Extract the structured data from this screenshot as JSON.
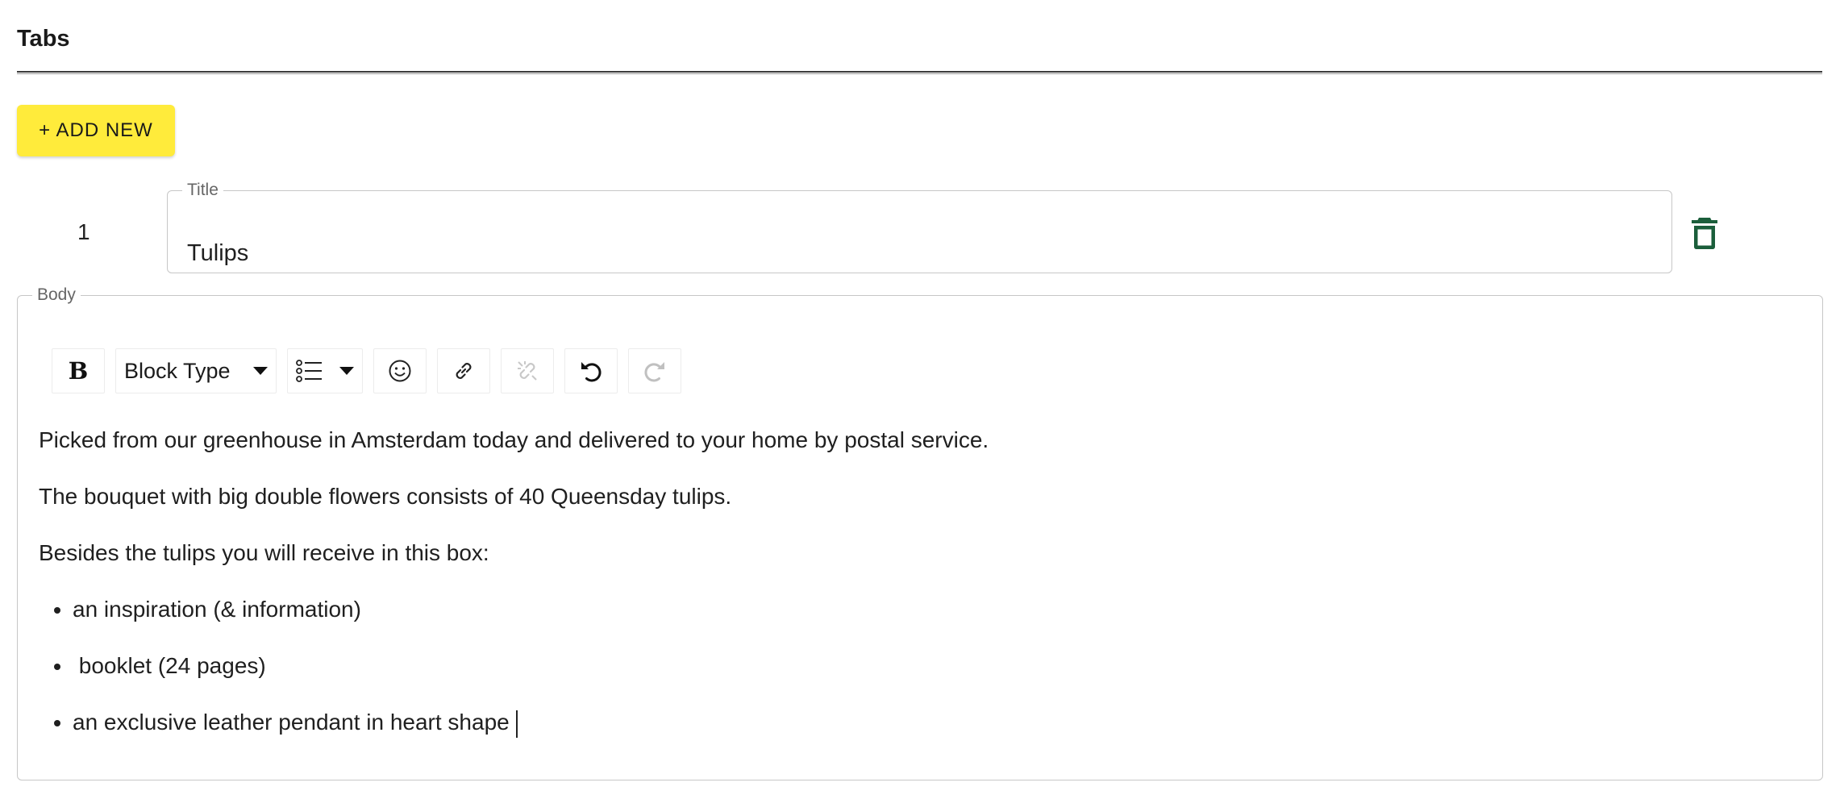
{
  "section": {
    "title": "Tabs"
  },
  "add_button": {
    "label": "+ ADD NEW"
  },
  "tab_item": {
    "index": "1",
    "title_legend": "Title",
    "title_value": "Tulips",
    "delete_icon": "delete-icon"
  },
  "body": {
    "legend": "Body",
    "toolbar": {
      "bold_label": "B",
      "block_type_label": "Block Type",
      "icons": [
        "bold-icon",
        "list-icon",
        "emoji-icon",
        "link-icon",
        "unlink-icon",
        "undo-icon",
        "redo-icon"
      ]
    },
    "paragraphs": [
      "Picked from our greenhouse in Amsterdam today and delivered to your home by postal service.",
      "The bouquet with big double flowers consists of 40 Queensday tulips.",
      "Besides the tulips you will receive in this box:"
    ],
    "list_items": [
      "an inspiration (& information)",
      " booklet (24 pages)",
      "an exclusive leather pendant in heart shape"
    ]
  },
  "colors": {
    "add_button_bg": "#ffeb3b",
    "delete_icon": "#1b5e3b",
    "disabled_icon": "#c8c8c8"
  }
}
